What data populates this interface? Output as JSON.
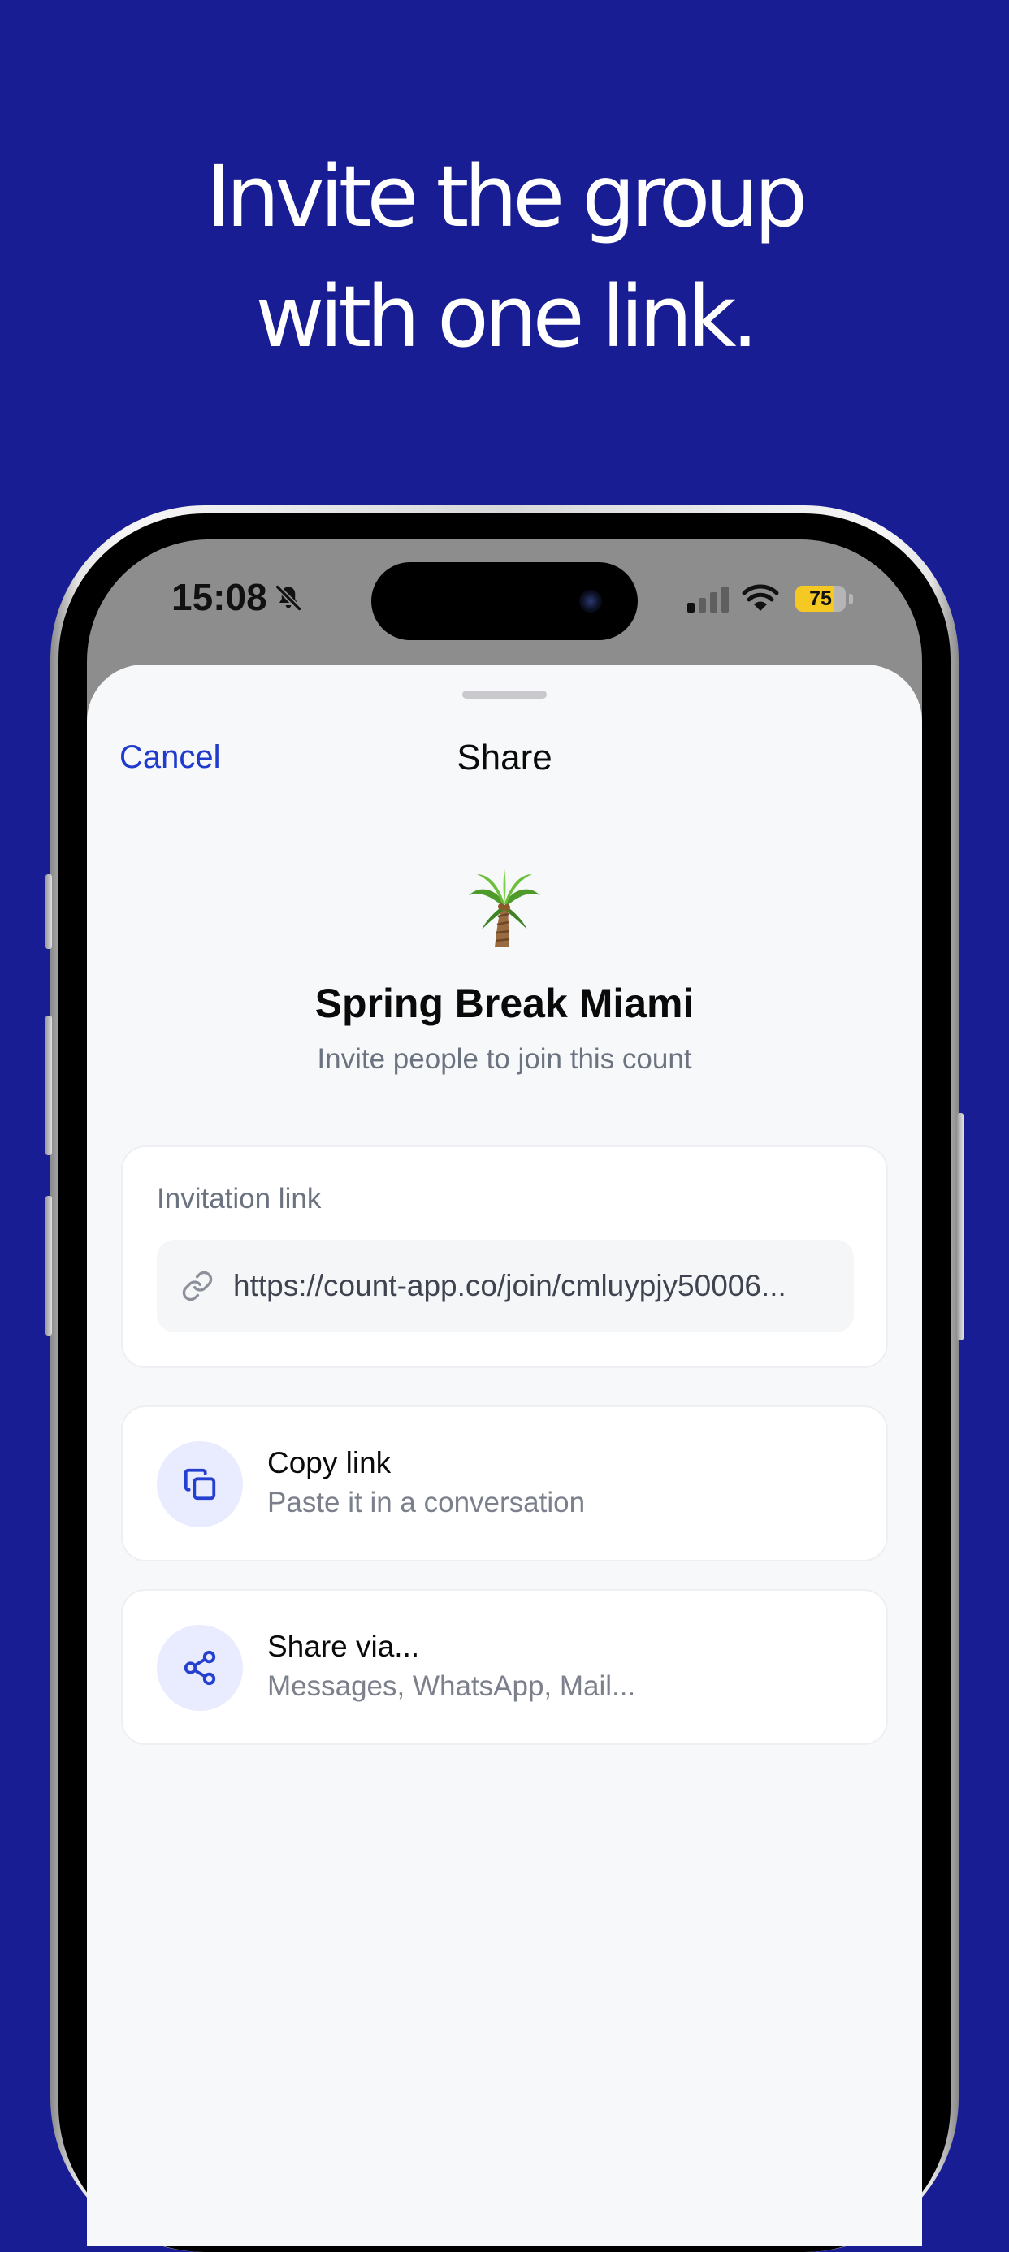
{
  "headline": {
    "line1": "Invite the group",
    "line2": "with one link."
  },
  "status_bar": {
    "time": "15:08",
    "battery_percent": "75",
    "battery_level": 0.75,
    "icons": [
      "bell-slash-icon",
      "cellular-signal-icon",
      "wifi-icon",
      "battery-icon"
    ]
  },
  "sheet": {
    "cancel_label": "Cancel",
    "title": "Share",
    "group_emoji": "palm-tree-icon",
    "group_name": "Spring Break Miami",
    "subtitle": "Invite people to join this count"
  },
  "invite": {
    "label": "Invitation link",
    "link": "https://count-app.co/join/cmluypjy50006..."
  },
  "actions": [
    {
      "title": "Copy link",
      "subtitle": "Paste it in a conversation",
      "icon": "copy-icon"
    },
    {
      "title": "Share via...",
      "subtitle": "Messages, WhatsApp, Mail...",
      "icon": "share-icon"
    }
  ],
  "colors": {
    "background": "#191D94",
    "accent": "#1F3ACD",
    "sheet": "#F7F8FA",
    "icon_circle": "#E9EBFF",
    "battery": "#F5C824"
  }
}
